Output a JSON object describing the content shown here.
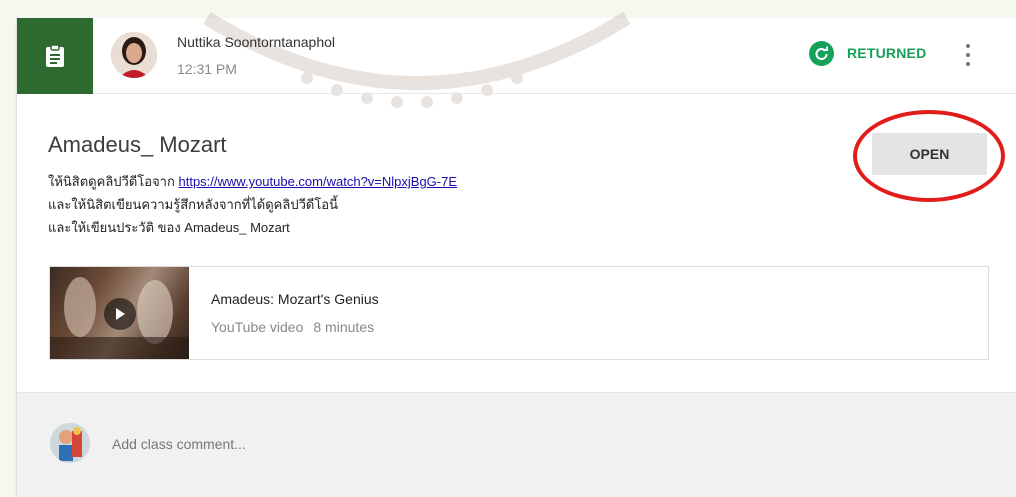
{
  "post": {
    "author": "Nuttika Soontorntanaphol",
    "time": "12:31 PM",
    "status": "RETURNED",
    "status_color": "#15a15a",
    "type_icon": "assignment-icon",
    "badge_color": "#2e6a30"
  },
  "assignment": {
    "title": "Amadeus_ Mozart",
    "line1_prefix": "ให้นิสิตดูคลิปวีดีโอจาก ",
    "line1_link": "https://www.youtube.com/watch?v=NlpxjBgG-7E",
    "line2": "และให้นิสิตเขียนความรู้สึกหลังจากที่ได้ดูคลิปวีดีโอนี้",
    "line3": "และให้เขียนประวัติ ของ Amadeus_ Mozart",
    "open_label": "OPEN"
  },
  "attachment": {
    "title": "Amadeus: Mozart's Genius",
    "kind": "YouTube video",
    "duration": "8 minutes"
  },
  "comment": {
    "placeholder": "Add class comment..."
  }
}
